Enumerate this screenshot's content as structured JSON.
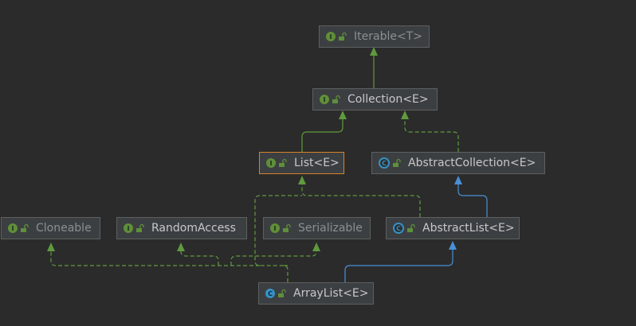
{
  "colors": {
    "background": "#2b2b2b",
    "node_fill": "#3c3f41",
    "node_border": "#5e6060",
    "selected_border": "#d6822b",
    "interface_badge": "#5f8f3a",
    "class_badge": "#3592c4",
    "implements_edge": "#5f9a3e",
    "extends_edge": "#4a8fd6"
  },
  "nodes": {
    "iterable": {
      "label": "Iterable<T>",
      "kind": "interface",
      "icon": "interface-icon"
    },
    "collection": {
      "label": "Collection<E>",
      "kind": "interface",
      "icon": "interface-icon"
    },
    "list": {
      "label": "List<E>",
      "kind": "interface",
      "icon": "interface-icon"
    },
    "abstract_collection": {
      "label": "AbstractCollection<E>",
      "kind": "abstract-class",
      "icon": "abstract-class-icon"
    },
    "cloneable": {
      "label": "Cloneable",
      "kind": "interface",
      "icon": "interface-icon"
    },
    "random_access": {
      "label": "RandomAccess",
      "kind": "interface",
      "icon": "interface-icon"
    },
    "serializable": {
      "label": "Serializable",
      "kind": "interface",
      "icon": "interface-icon"
    },
    "abstract_list": {
      "label": "AbstractList<E>",
      "kind": "abstract-class",
      "icon": "abstract-class-icon"
    },
    "array_list": {
      "label": "ArrayList<E>",
      "kind": "class",
      "icon": "class-icon"
    }
  },
  "badge_letters": {
    "interface": "I",
    "class": "C",
    "abstract": "C"
  },
  "selected_node": "List<E>"
}
